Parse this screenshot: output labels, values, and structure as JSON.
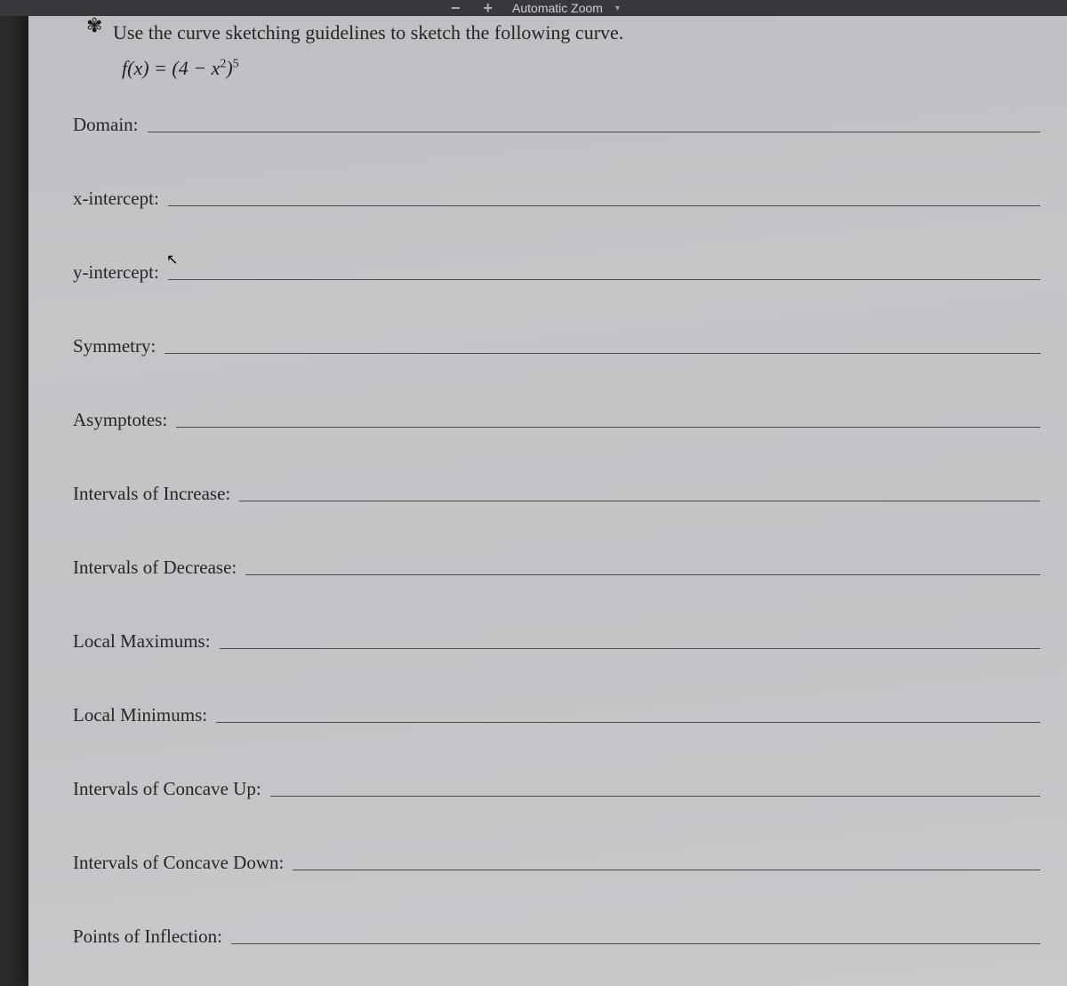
{
  "toolbar": {
    "zoom_out": "−",
    "zoom_in": "+",
    "zoom_label": "Automatic Zoom"
  },
  "problem": {
    "instruction": "Use the curve sketching guidelines to sketch the following curve.",
    "formula_prefix": "f",
    "formula_paren_open": "(",
    "formula_var": "x",
    "formula_paren_close": ") = (4 − ",
    "formula_var2": "x",
    "formula_sup1": "2",
    "formula_paren_close2": ")",
    "formula_sup2": "5"
  },
  "fields": [
    {
      "label": "Domain:"
    },
    {
      "label": "x-intercept:"
    },
    {
      "label": "y-intercept:"
    },
    {
      "label": "Symmetry:"
    },
    {
      "label": "Asymptotes:"
    },
    {
      "label": "Intervals of Increase:"
    },
    {
      "label": "Intervals of Decrease:"
    },
    {
      "label": "Local Maximums:"
    },
    {
      "label": "Local Minimums:"
    },
    {
      "label": "Intervals of Concave Up:"
    },
    {
      "label": "Intervals of Concave Down:"
    },
    {
      "label": "Points of Inflection:"
    }
  ]
}
